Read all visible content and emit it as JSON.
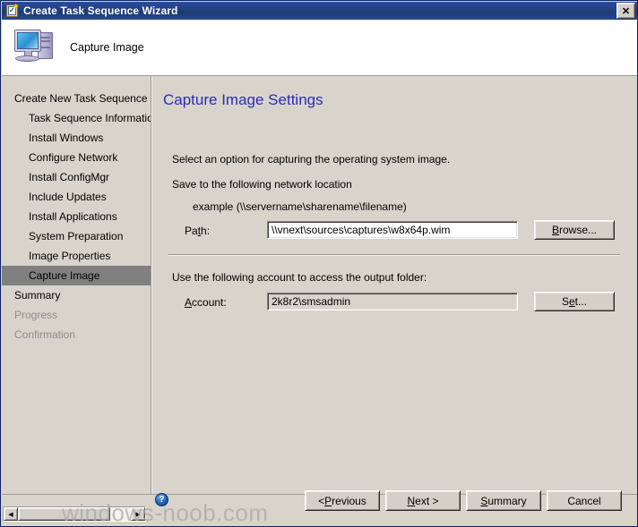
{
  "window": {
    "title": "Create Task Sequence Wizard",
    "title_icon": "task-sequence-clipboard-icon",
    "close_label": "✕"
  },
  "banner": {
    "icon": "computer-icon",
    "title": "Capture Image"
  },
  "sidebar": {
    "items": [
      {
        "label": "Create New Task Sequence",
        "indent": false,
        "state": "normal"
      },
      {
        "label": "Task Sequence Information",
        "indent": true,
        "state": "normal"
      },
      {
        "label": "Install Windows",
        "indent": true,
        "state": "normal"
      },
      {
        "label": "Configure Network",
        "indent": true,
        "state": "normal"
      },
      {
        "label": "Install ConfigMgr",
        "indent": true,
        "state": "normal"
      },
      {
        "label": "Include Updates",
        "indent": true,
        "state": "normal"
      },
      {
        "label": "Install Applications",
        "indent": true,
        "state": "normal"
      },
      {
        "label": "System Preparation",
        "indent": true,
        "state": "normal"
      },
      {
        "label": "Image Properties",
        "indent": true,
        "state": "normal"
      },
      {
        "label": "Capture Image",
        "indent": true,
        "state": "selected"
      },
      {
        "label": "Summary",
        "indent": false,
        "state": "normal"
      },
      {
        "label": "Progress",
        "indent": false,
        "state": "disabled"
      },
      {
        "label": "Confirmation",
        "indent": false,
        "state": "disabled"
      }
    ],
    "scrollbar": {
      "left_arrow": "◀",
      "right_arrow": "▶"
    }
  },
  "main": {
    "heading": "Capture Image Settings",
    "intro_text": "Select an option for capturing the operating system image.",
    "network_section_label": "Save to the following network location",
    "example_text": "example (\\\\servername\\sharename\\filename)",
    "path_label_pre": "Pa",
    "path_label_accel": "t",
    "path_label_post": "h:",
    "path_value": "\\\\vnext\\sources\\captures\\w8x64p.wim",
    "browse_pre": "",
    "browse_accel": "B",
    "browse_post": "rowse...",
    "account_section_label": "Use the following account to access the output folder:",
    "account_label_accel": "A",
    "account_label_post": "ccount:",
    "account_value": "2k8r2\\smsadmin",
    "set_pre": "S",
    "set_accel": "e",
    "set_post": "t..."
  },
  "footer": {
    "help_icon": "help-question-icon",
    "help_glyph": "?",
    "buttons": [
      {
        "pre": "< ",
        "accel": "P",
        "post": "revious"
      },
      {
        "pre": "",
        "accel": "N",
        "post": "ext >"
      },
      {
        "pre": "",
        "accel": "S",
        "post": "ummary"
      },
      {
        "pre": "Cancel",
        "accel": "",
        "post": ""
      }
    ]
  },
  "watermark": "windows-noob.com",
  "colors": {
    "titlebar": "#204080",
    "dialog_face": "#d8d4cc",
    "heading_blue": "#2b2bb5",
    "selection_grey": "#808080",
    "disabled_text": "#8c8c8c"
  }
}
